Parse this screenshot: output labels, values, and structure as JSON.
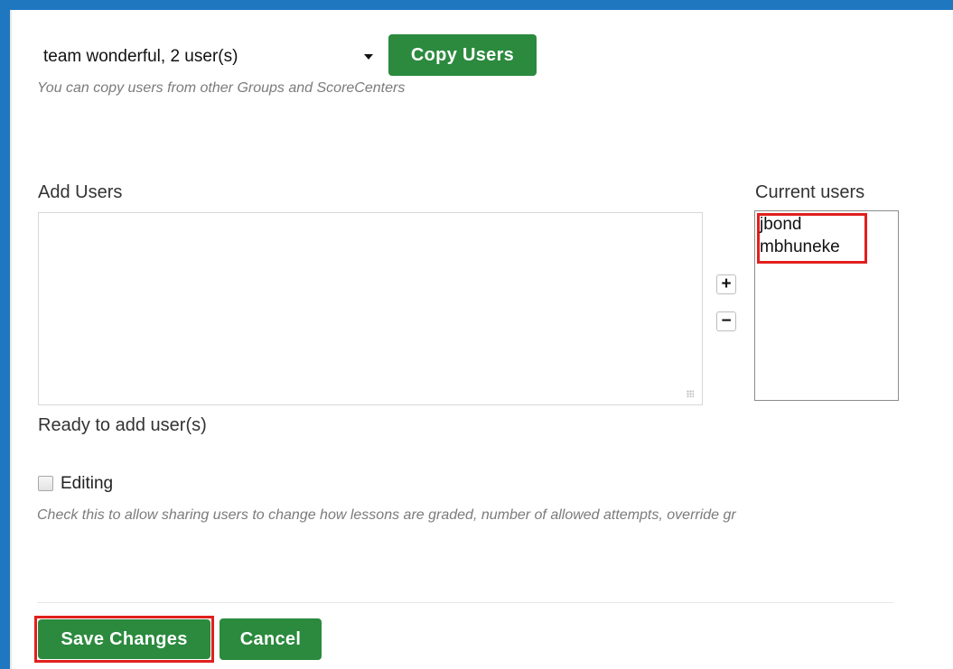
{
  "copy_section": {
    "group_select_value": "team wonderful, 2 user(s)",
    "copy_button_label": "Copy Users",
    "hint": "You can copy users from other Groups and ScoreCenters"
  },
  "add_users": {
    "label": "Add Users",
    "textarea_value": "",
    "status": "Ready to add user(s)"
  },
  "transfer_buttons": {
    "add_symbol": "+",
    "remove_symbol": "−"
  },
  "current_users": {
    "label": "Current users",
    "items": [
      "jbond",
      "mbhuneke"
    ]
  },
  "editing": {
    "checked": false,
    "label": "Editing",
    "hint": "Check this to allow sharing users to change how lessons are graded, number of allowed attempts, override gr"
  },
  "actions": {
    "save_label": "Save Changes",
    "cancel_label": "Cancel"
  },
  "colors": {
    "frame": "#1f77c0",
    "button_green": "#2b8a3e",
    "highlight_red": "#e0201e"
  }
}
